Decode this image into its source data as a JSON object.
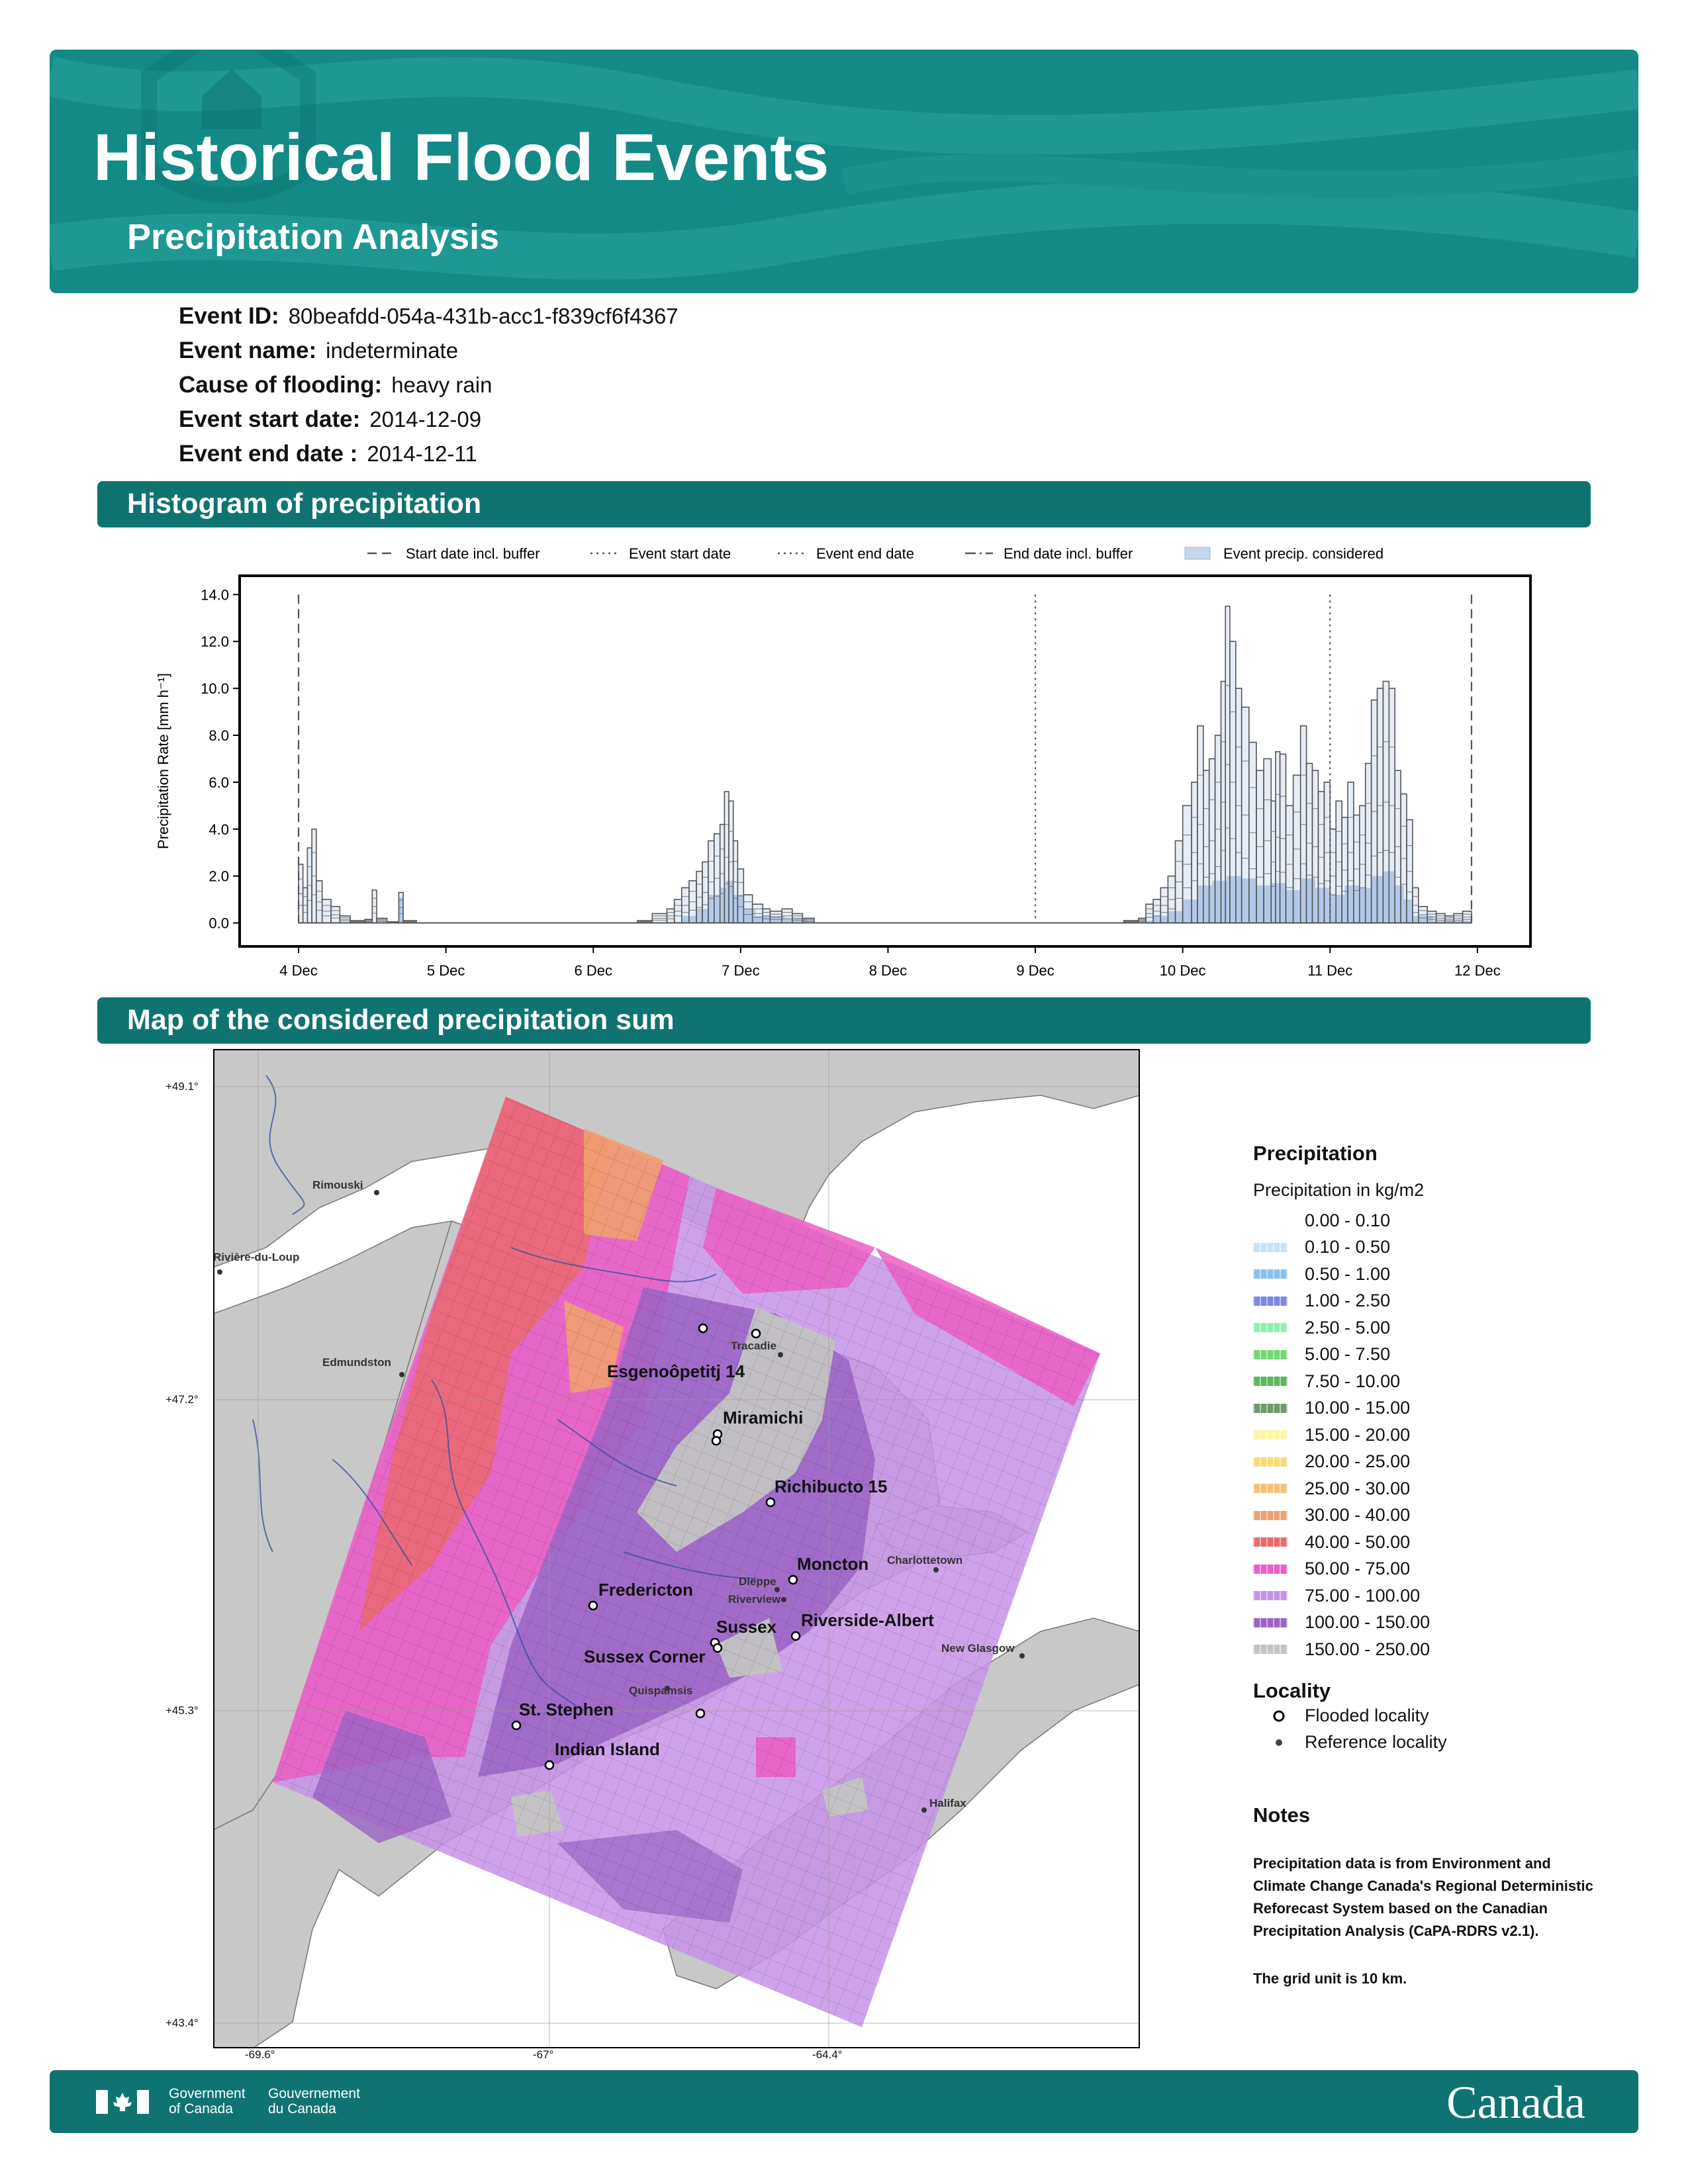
{
  "header": {
    "title": "Historical Flood Events",
    "subtitle": "Precipitation Analysis"
  },
  "event": {
    "id_label": "Event ID:",
    "id_value": "80beafdd-054a-431b-acc1-f839cf6f4367",
    "name_label": "Event name:",
    "name_value": "indeterminate",
    "cause_label": "Cause of flooding:",
    "cause_value": "heavy rain",
    "start_label": "Event start date:",
    "start_value": "2014-12-09",
    "end_label": "Event end date :",
    "end_value": "2014-12-11"
  },
  "sections": {
    "histogram": "Histogram of precipitation",
    "map": "Map of the considered precipitation sum"
  },
  "chart_data": {
    "type": "bar",
    "ylabel": "Precipitation Rate [mm h⁻¹]",
    "ylim": [
      -1.0,
      14.8
    ],
    "xlim": [
      3.6,
      12.36
    ],
    "y_ticks": [
      "0.0",
      "2.0",
      "4.0",
      "6.0",
      "8.0",
      "10.0",
      "12.0",
      "14.0"
    ],
    "x_ticks": [
      {
        "day": 4,
        "label": "4 Dec"
      },
      {
        "day": 5,
        "label": "5 Dec"
      },
      {
        "day": 6,
        "label": "6 Dec"
      },
      {
        "day": 7,
        "label": "7 Dec"
      },
      {
        "day": 8,
        "label": "8 Dec"
      },
      {
        "day": 9,
        "label": "9 Dec"
      },
      {
        "day": 10,
        "label": "10 Dec"
      },
      {
        "day": 11,
        "label": "11 Dec"
      },
      {
        "day": 12,
        "label": "12 Dec"
      }
    ],
    "legend": {
      "placement": "top",
      "entries": [
        {
          "label": "Start date incl. buffer",
          "style": "dashed"
        },
        {
          "label": "Event start date",
          "style": "dotted"
        },
        {
          "label": "Event end date",
          "style": "dotted"
        },
        {
          "label": "End date incl. buffer",
          "style": "dashdot"
        },
        {
          "label": "Event precip. considered",
          "style": "patch"
        }
      ]
    },
    "vlines": [
      {
        "day": 4.0,
        "style": "dashed"
      },
      {
        "day": 9.0,
        "style": "dotted"
      },
      {
        "day": 11.0,
        "style": "dotted"
      },
      {
        "day": 11.96,
        "style": "dashed"
      }
    ],
    "envelope": [
      [
        4.0,
        2.5
      ],
      [
        4.03,
        1.5
      ],
      [
        4.06,
        3.2
      ],
      [
        4.09,
        4.0
      ],
      [
        4.12,
        1.8
      ],
      [
        4.16,
        1.0
      ],
      [
        4.22,
        0.7
      ],
      [
        4.28,
        0.3
      ],
      [
        4.35,
        0.1
      ],
      [
        4.45,
        0.15
      ],
      [
        4.5,
        1.4
      ],
      [
        4.53,
        0.2
      ],
      [
        4.6,
        0.05
      ],
      [
        4.68,
        1.3
      ],
      [
        4.71,
        0.1
      ],
      [
        4.8,
        0.0
      ],
      [
        6.2,
        0.0
      ],
      [
        6.3,
        0.1
      ],
      [
        6.4,
        0.4
      ],
      [
        6.5,
        0.6
      ],
      [
        6.55,
        1.0
      ],
      [
        6.6,
        1.5
      ],
      [
        6.65,
        1.8
      ],
      [
        6.7,
        2.2
      ],
      [
        6.74,
        2.6
      ],
      [
        6.78,
        3.5
      ],
      [
        6.82,
        3.8
      ],
      [
        6.86,
        4.2
      ],
      [
        6.89,
        5.6
      ],
      [
        6.92,
        5.2
      ],
      [
        6.95,
        3.5
      ],
      [
        6.98,
        2.3
      ],
      [
        7.02,
        1.2
      ],
      [
        7.08,
        0.8
      ],
      [
        7.15,
        0.6
      ],
      [
        7.2,
        0.5
      ],
      [
        7.28,
        0.6
      ],
      [
        7.35,
        0.4
      ],
      [
        7.42,
        0.2
      ],
      [
        7.5,
        0.0
      ],
      [
        9.5,
        0.0
      ],
      [
        9.6,
        0.1
      ],
      [
        9.7,
        0.2
      ],
      [
        9.75,
        0.8
      ],
      [
        9.8,
        1.0
      ],
      [
        9.85,
        1.5
      ],
      [
        9.9,
        2.0
      ],
      [
        9.95,
        3.5
      ],
      [
        10.0,
        5.0
      ],
      [
        10.06,
        6.0
      ],
      [
        10.1,
        8.4
      ],
      [
        10.14,
        6.5
      ],
      [
        10.18,
        7.0
      ],
      [
        10.22,
        8.0
      ],
      [
        10.26,
        10.3
      ],
      [
        10.29,
        13.5
      ],
      [
        10.32,
        12.0
      ],
      [
        10.36,
        10.0
      ],
      [
        10.4,
        9.2
      ],
      [
        10.45,
        7.7
      ],
      [
        10.5,
        6.5
      ],
      [
        10.55,
        7.0
      ],
      [
        10.6,
        5.2
      ],
      [
        10.63,
        7.3
      ],
      [
        10.66,
        7.2
      ],
      [
        10.7,
        5.0
      ],
      [
        10.75,
        6.3
      ],
      [
        10.8,
        8.4
      ],
      [
        10.84,
        6.8
      ],
      [
        10.88,
        6.5
      ],
      [
        10.92,
        5.6
      ],
      [
        10.96,
        6.0
      ],
      [
        11.0,
        4.0
      ],
      [
        11.04,
        5.2
      ],
      [
        11.08,
        4.5
      ],
      [
        11.12,
        6.0
      ],
      [
        11.16,
        4.6
      ],
      [
        11.2,
        5.0
      ],
      [
        11.24,
        6.8
      ],
      [
        11.28,
        9.5
      ],
      [
        11.32,
        10.0
      ],
      [
        11.36,
        10.3
      ],
      [
        11.4,
        10.0
      ],
      [
        11.44,
        6.5
      ],
      [
        11.48,
        5.5
      ],
      [
        11.52,
        4.4
      ],
      [
        11.56,
        1.5
      ],
      [
        11.6,
        0.7
      ],
      [
        11.66,
        0.5
      ],
      [
        11.72,
        0.4
      ],
      [
        11.78,
        0.3
      ],
      [
        11.84,
        0.4
      ],
      [
        11.9,
        0.5
      ],
      [
        11.96,
        0.3
      ]
    ],
    "considered": [
      [
        4.68,
        1.1
      ],
      [
        4.71,
        0.0
      ],
      [
        6.6,
        0.3
      ],
      [
        6.7,
        0.6
      ],
      [
        6.78,
        1.2
      ],
      [
        6.86,
        1.5
      ],
      [
        6.9,
        1.8
      ],
      [
        6.95,
        1.2
      ],
      [
        7.02,
        0.6
      ],
      [
        7.1,
        0.3
      ],
      [
        7.3,
        0.2
      ],
      [
        7.45,
        0.0
      ],
      [
        9.72,
        0.1
      ],
      [
        9.8,
        0.3
      ],
      [
        9.9,
        0.5
      ],
      [
        10.0,
        1.0
      ],
      [
        10.1,
        1.6
      ],
      [
        10.2,
        1.8
      ],
      [
        10.3,
        2.0
      ],
      [
        10.4,
        1.9
      ],
      [
        10.5,
        1.6
      ],
      [
        10.6,
        1.7
      ],
      [
        10.7,
        1.4
      ],
      [
        10.8,
        1.9
      ],
      [
        10.9,
        1.5
      ],
      [
        11.0,
        1.2
      ],
      [
        11.1,
        1.6
      ],
      [
        11.2,
        1.5
      ],
      [
        11.28,
        2.0
      ],
      [
        11.36,
        2.2
      ],
      [
        11.44,
        1.6
      ],
      [
        11.5,
        1.0
      ],
      [
        11.56,
        0.3
      ],
      [
        11.7,
        0.1
      ],
      [
        11.96,
        0.0
      ]
    ]
  },
  "map": {
    "lat_labels": [
      "+49.1°",
      "+47.2°",
      "+45.3°",
      "+43.4°"
    ],
    "lon_labels": [
      "-69.6°",
      "-67°",
      "-64.4°"
    ],
    "places_flooded": [
      "Esgenoôpetitj 14",
      "Miramichi",
      "Richibucto 15",
      "Fredericton",
      "Moncton",
      "Sussex",
      "Riverside-Albert",
      "Sussex Corner",
      "St. Stephen",
      "Indian Island"
    ],
    "places_reference": [
      "Rimouski",
      "Rivière-du-Loup",
      "Edmundston",
      "Tracadie",
      "Charlottetown",
      "Dieppe",
      "Riverview",
      "New Glasgow",
      "Quispamsis",
      "Halifax"
    ]
  },
  "legend": {
    "title": "Precipitation",
    "subtitle": "Precipitation in kg/m2",
    "classes": [
      {
        "label": "0.00 - 0.10",
        "color": "#ffffff"
      },
      {
        "label": "0.10 - 0.50",
        "color": "#c6e2f7"
      },
      {
        "label": "0.50 - 1.00",
        "color": "#86c2ec"
      },
      {
        "label": "1.00 - 2.50",
        "color": "#7e86e6"
      },
      {
        "label": "2.50 - 5.00",
        "color": "#8ff0b0"
      },
      {
        "label": "5.00 - 7.50",
        "color": "#72d872"
      },
      {
        "label": "7.50 - 10.00",
        "color": "#5cb85c"
      },
      {
        "label": "10.00 - 15.00",
        "color": "#6e9a6e"
      },
      {
        "label": "15.00 - 20.00",
        "color": "#fdf7a3"
      },
      {
        "label": "20.00 - 25.00",
        "color": "#f8dc78"
      },
      {
        "label": "25.00 - 30.00",
        "color": "#f4c178"
      },
      {
        "label": "30.00 - 40.00",
        "color": "#f0a070"
      },
      {
        "label": "40.00 - 50.00",
        "color": "#ec6a6a"
      },
      {
        "label": "50.00 - 75.00",
        "color": "#ec5ec4"
      },
      {
        "label": "75.00 - 100.00",
        "color": "#c593e9"
      },
      {
        "label": "100.00 - 150.00",
        "color": "#9a64c4"
      },
      {
        "label": "150.00 - 250.00",
        "color": "#c4c4c4"
      }
    ],
    "locality_title": "Locality",
    "flooded_label": "Flooded locality",
    "reference_label": "Reference locality"
  },
  "notes": {
    "title": "Notes",
    "text1": "Precipitation data is from Environment and Climate Change Canada's Regional Deterministic Reforecast System based on the Canadian Precipitation Analysis (CaPA-RDRS v2.1).",
    "text2": "The grid unit is 10 km."
  },
  "footer": {
    "gov_en_1": "Government",
    "gov_en_2": "of Canada",
    "gov_fr_1": "Gouvernement",
    "gov_fr_2": "du Canada",
    "wordmark": "Canada"
  }
}
